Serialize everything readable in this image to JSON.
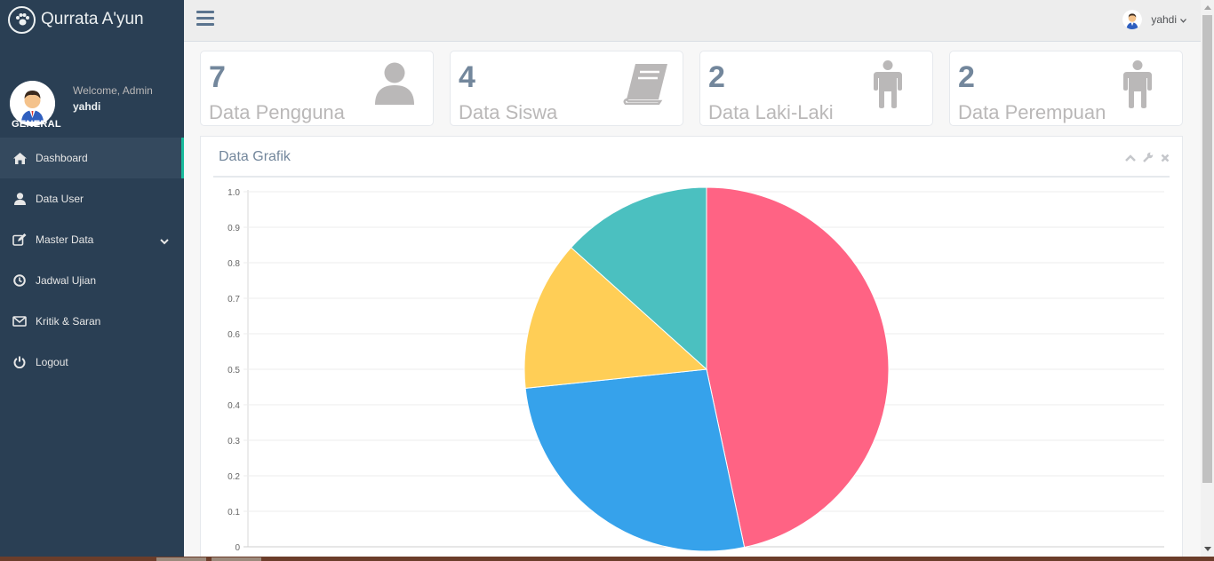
{
  "brand": {
    "title": "Qurrata A'yun"
  },
  "profile": {
    "welcome": "Welcome, Admin",
    "name": "yahdi"
  },
  "sidebar": {
    "section_title": "GENERAL",
    "items": [
      {
        "label": "Dashboard",
        "icon": "home-icon"
      },
      {
        "label": "Data User",
        "icon": "user-icon"
      },
      {
        "label": "Master Data",
        "icon": "edit-icon"
      },
      {
        "label": "Jadwal Ujian",
        "icon": "clock-icon"
      },
      {
        "label": "Kritik & Saran",
        "icon": "envelope-icon"
      },
      {
        "label": "Logout",
        "icon": "power-icon"
      }
    ]
  },
  "topnav": {
    "user_name": "yahdi"
  },
  "tiles": [
    {
      "count": "7",
      "label": "Data Pengguna",
      "icon": "user-icon"
    },
    {
      "count": "4",
      "label": "Data Siswa",
      "icon": "book-icon"
    },
    {
      "count": "2",
      "label": "Data Laki-Laki",
      "icon": "male-icon"
    },
    {
      "count": "2",
      "label": "Data Perempuan",
      "icon": "male-icon"
    }
  ],
  "panel": {
    "title": "Data Grafik"
  },
  "colors": {
    "sidebar": "#2a3f54",
    "accent": "#1abb9c",
    "pink": "#ff6384",
    "blue": "#36a2eb",
    "yellow": "#ffce56",
    "teal": "#4bc0c0"
  },
  "chart_data": {
    "type": "pie",
    "categories": [
      "",
      "",
      "",
      ""
    ],
    "values": [
      7,
      4,
      2,
      2
    ],
    "colors": [
      "#ff6384",
      "#36a2eb",
      "#ffce56",
      "#4bc0c0"
    ],
    "yticks": [
      "1.0",
      "0.9",
      "0.8",
      "0.7",
      "0.6",
      "0.5",
      "0.4",
      "0.3",
      "0.2",
      "0.1",
      "0"
    ],
    "ylim": [
      0,
      1
    ],
    "grid": true
  }
}
